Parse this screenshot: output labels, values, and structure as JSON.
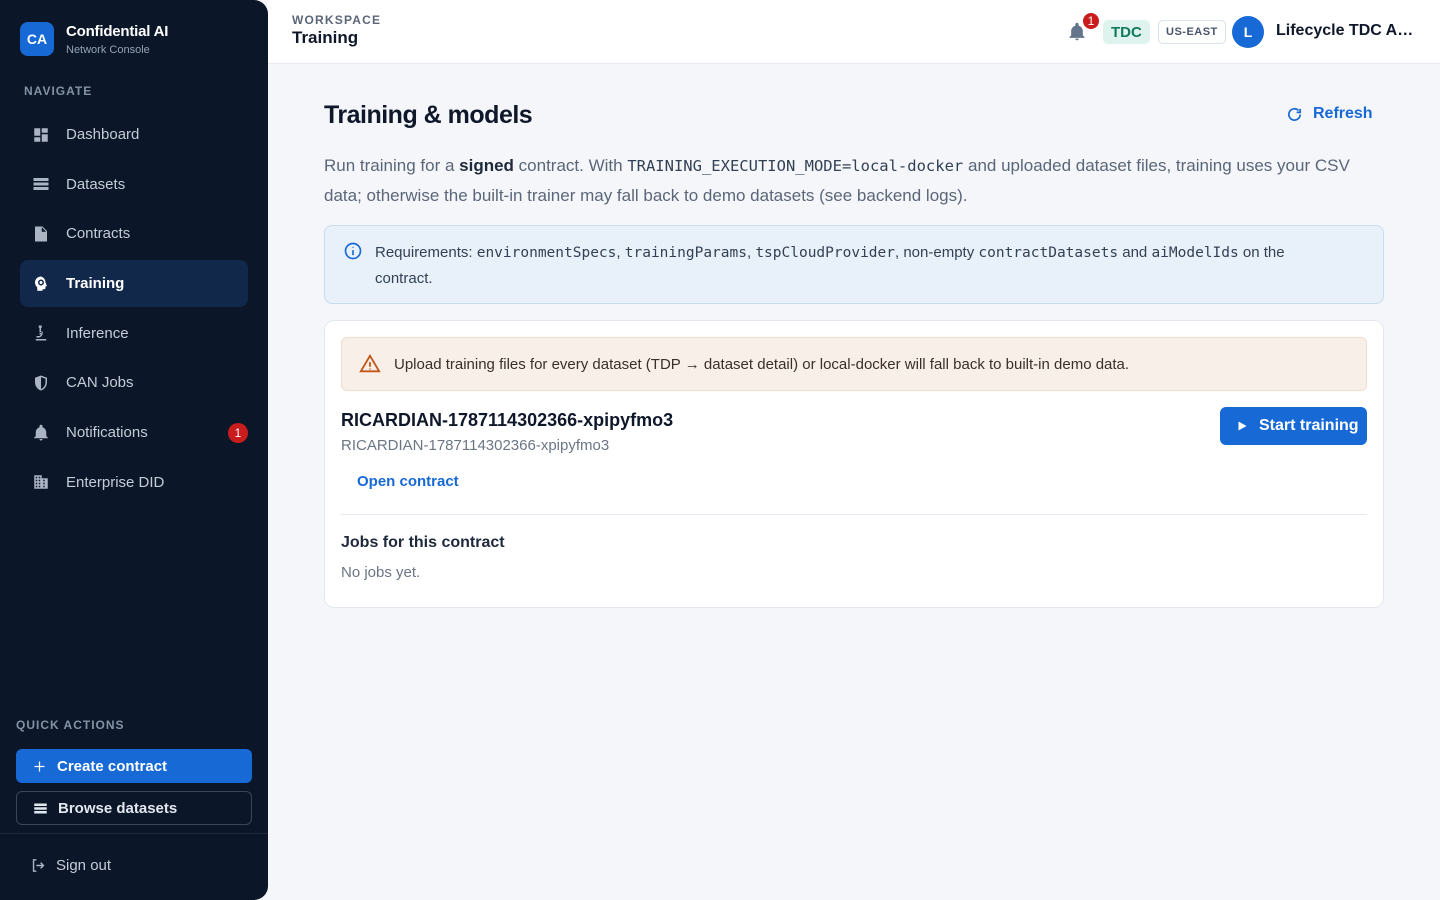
{
  "brand": {
    "logo": "CA",
    "title": "Confidential AI",
    "subtitle": "Network Console"
  },
  "sidebar": {
    "nav_header": "NAVIGATE",
    "items": [
      {
        "label": "Dashboard",
        "icon": "dashboard-icon"
      },
      {
        "label": "Datasets",
        "icon": "list-icon"
      },
      {
        "label": "Contracts",
        "icon": "document-icon"
      },
      {
        "label": "Training",
        "icon": "brain-icon",
        "active": true
      },
      {
        "label": "Inference",
        "icon": "microscope-icon"
      },
      {
        "label": "CAN Jobs",
        "icon": "shield-icon"
      },
      {
        "label": "Notifications",
        "icon": "bell-icon",
        "badge": "1"
      },
      {
        "label": "Enterprise DID",
        "icon": "building-icon"
      }
    ],
    "quick_actions_header": "QUICK ACTIONS",
    "create_contract": "Create contract",
    "browse_datasets": "Browse datasets",
    "sign_out": "Sign out"
  },
  "topbar": {
    "breadcrumb_label": "WORKSPACE",
    "breadcrumb_title": "Training",
    "notification_count": "1",
    "org_chip": "TDC",
    "region_chip": "US-EAST",
    "avatar_initial": "L",
    "user_name": "Lifecycle TDC Admin"
  },
  "main": {
    "title": "Training & models",
    "refresh_label": "Refresh",
    "desc": {
      "p1": "Run training for a ",
      "bold": "signed",
      "p2": " contract. With ",
      "code": "TRAINING_EXECUTION_MODE=local-docker",
      "p3": " and uploaded dataset files, training uses your CSV data; otherwise the built-in trainer may fall back to demo datasets (see backend logs)."
    },
    "info": {
      "prefix": "Requirements: ",
      "code1": "environmentSpecs",
      "sep1": ", ",
      "code2": "trainingParams",
      "sep2": ", ",
      "code3": "tspCloudProvider",
      "mid": ", non-empty ",
      "code4": "contractDatasets",
      "and": " and ",
      "code5": "aiModelIds",
      "suffix": " on the contract."
    },
    "warning": "Upload training files for every dataset (TDP → dataset detail) or local-docker will fall back to built-in demo data.",
    "contract": {
      "title": "RICARDIAN-1787114302366-xpipyfmo3",
      "subtitle": "RICARDIAN-1787114302366-xpipyfmo3",
      "open_link": "Open contract",
      "start_button": "Start training",
      "jobs_title": "Jobs for this contract",
      "jobs_empty": "No jobs yet."
    }
  },
  "colors": {
    "accent": "#1769d6",
    "sidebar_bg": "#0b1628",
    "badge": "#c91c1c",
    "warning": "#c2571a"
  }
}
